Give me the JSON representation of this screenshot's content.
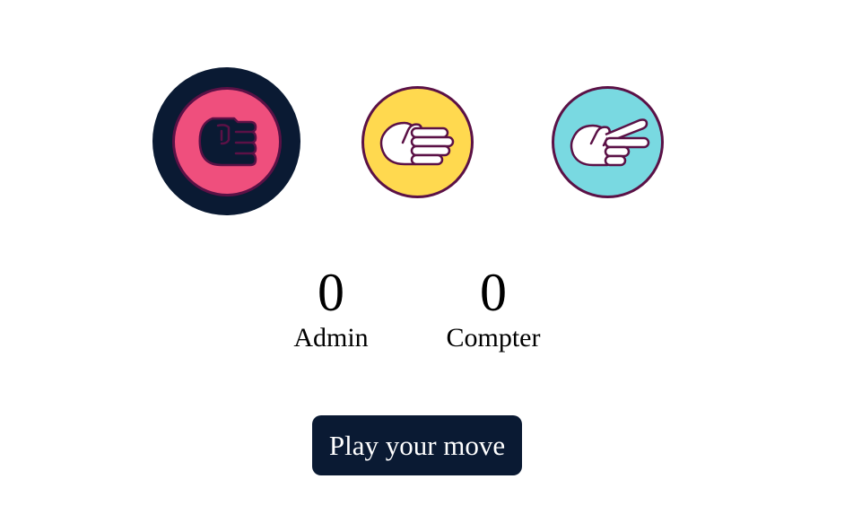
{
  "choices": [
    {
      "id": "rock",
      "icon": "rock-fist-icon",
      "selected": true,
      "color": "#ef4f7d"
    },
    {
      "id": "paper",
      "icon": "paper-hand-icon",
      "selected": false,
      "color": "#ffd94f"
    },
    {
      "id": "scissors",
      "icon": "scissors-hand-icon",
      "selected": false,
      "color": "#79d9e1"
    }
  ],
  "scores": {
    "admin": {
      "value": "0",
      "label": "Admin"
    },
    "computer": {
      "value": "0",
      "label": "Compter"
    }
  },
  "play_button": {
    "label": "Play your move"
  },
  "colors": {
    "selected_ring": "#0a1a33",
    "outline": "#5b1146",
    "button_bg": "#0a1a33",
    "button_text": "#ffffff"
  }
}
